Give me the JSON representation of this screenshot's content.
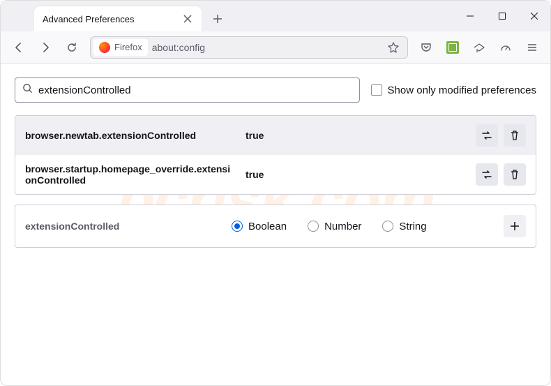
{
  "window": {
    "tab": {
      "title": "Advanced Preferences"
    },
    "controls": {
      "minimize": "minimize",
      "maximize": "maximize",
      "close": "close"
    }
  },
  "toolbar": {
    "identity_label": "Firefox",
    "url": "about:config"
  },
  "search": {
    "value": "extensionControlled",
    "filter_label": "Show only modified preferences"
  },
  "prefs": [
    {
      "name": "browser.newtab.extensionControlled",
      "value": "true"
    },
    {
      "name": "browser.startup.homepage_override.extensionControlled",
      "value": "true"
    }
  ],
  "add": {
    "name": "extensionControlled",
    "types": [
      "Boolean",
      "Number",
      "String"
    ],
    "selected": "Boolean"
  },
  "watermark": "pcrisk.com"
}
